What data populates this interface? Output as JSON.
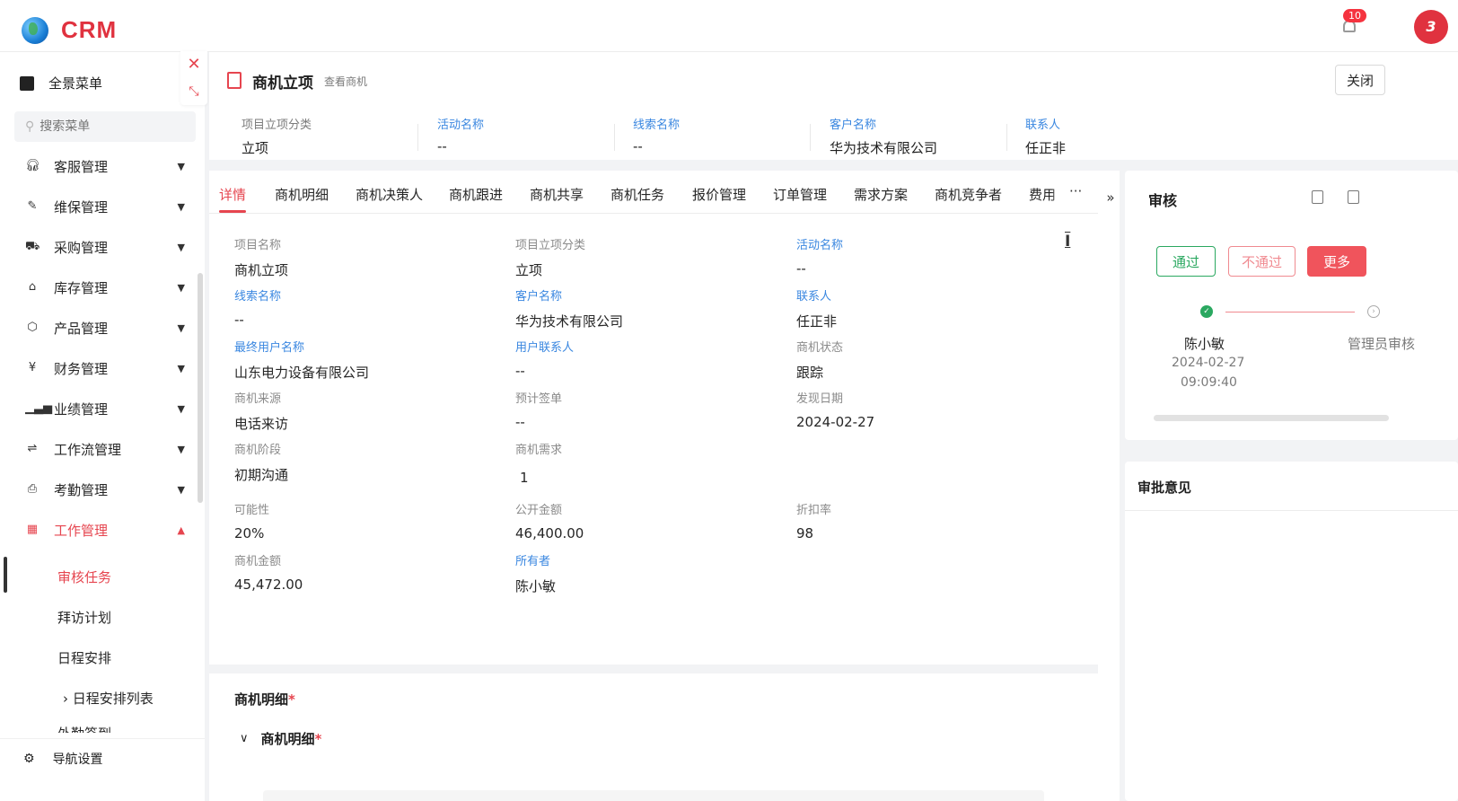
{
  "app": {
    "logo_text": "CRM",
    "notification_count": "10",
    "avatar_text": "3"
  },
  "sidebar": {
    "full_menu": "全景菜单",
    "search_placeholder": "搜索菜单",
    "items": [
      {
        "label": "客服管理",
        "icon": "headset-icon"
      },
      {
        "label": "维保管理",
        "icon": "wrench-icon"
      },
      {
        "label": "采购管理",
        "icon": "cart-icon"
      },
      {
        "label": "库存管理",
        "icon": "warehouse-icon"
      },
      {
        "label": "产品管理",
        "icon": "box-icon"
      },
      {
        "label": "财务管理",
        "icon": "finance-icon"
      },
      {
        "label": "业绩管理",
        "icon": "chart-icon"
      },
      {
        "label": "工作流管理",
        "icon": "workflow-icon"
      },
      {
        "label": "考勤管理",
        "icon": "attendance-icon"
      },
      {
        "label": "工作管理",
        "icon": "grid-icon"
      }
    ],
    "sub_items": [
      "审核任务",
      "拜访计划",
      "日程安排",
      "日程安排列表",
      "外勤签到"
    ],
    "bottom": "导航设置"
  },
  "header": {
    "title": "商机立项",
    "subtitle": "查看商机",
    "close_label": "关闭"
  },
  "summary": [
    {
      "label": "项目立项分类",
      "value": "立项",
      "link": false
    },
    {
      "label": "活动名称",
      "value": "--",
      "link": true
    },
    {
      "label": "线索名称",
      "value": "--",
      "link": true
    },
    {
      "label": "客户名称",
      "value": "华为技术有限公司",
      "link": true
    },
    {
      "label": "联系人",
      "value": "任正非",
      "link": true
    }
  ],
  "tabs": [
    "详情",
    "商机明细",
    "商机决策人",
    "商机跟进",
    "商机共享",
    "商机任务",
    "报价管理",
    "订单管理",
    "需求方案",
    "商机竞争者",
    "费用"
  ],
  "tabs_more": "···",
  "detail": {
    "fields": [
      {
        "label": "项目名称",
        "value": "商机立项",
        "link": false
      },
      {
        "label": "项目立项分类",
        "value": "立项",
        "link": false
      },
      {
        "label": "活动名称",
        "value": "--",
        "link": true
      },
      {
        "label": "线索名称",
        "value": "--",
        "link": true
      },
      {
        "label": "客户名称",
        "value": "华为技术有限公司",
        "link": true
      },
      {
        "label": "联系人",
        "value": "任正非",
        "link": true
      },
      {
        "label": "最终用户名称",
        "value": "山东电力设备有限公司",
        "link": true
      },
      {
        "label": "用户联系人",
        "value": "--",
        "link": true
      },
      {
        "label": "商机状态",
        "value": "跟踪",
        "link": false
      },
      {
        "label": "商机来源",
        "value": "电话来访",
        "link": false
      },
      {
        "label": "预计签单",
        "value": "--",
        "link": false
      },
      {
        "label": "发现日期",
        "value": "2024-02-27",
        "link": false
      },
      {
        "label": "商机阶段",
        "value": "初期沟通",
        "link": false
      },
      {
        "label": "商机需求",
        "value": "1",
        "link": false
      },
      {
        "label": "可能性",
        "value": "20%",
        "link": false
      },
      {
        "label": "公开金额",
        "value": "46,400.00",
        "link": false
      },
      {
        "label": "折扣率",
        "value": "98",
        "link": false
      },
      {
        "label": "商机金额",
        "value": "45,472.00",
        "link": false
      },
      {
        "label": "所有者",
        "value": "陈小敏",
        "link": true
      }
    ]
  },
  "section": {
    "title": "商机明细",
    "sub_title": "商机明细",
    "required_mark": "*"
  },
  "audit": {
    "title": "审核",
    "pass_label": "通过",
    "reject_label": "不通过",
    "more_label": "更多",
    "step1_name": "陈小敏",
    "step1_date": "2024-02-27",
    "step1_time": "09:09:40",
    "step2_name": "管理员审核"
  },
  "opinion": {
    "title": "审批意见"
  },
  "colors": {
    "accent": "#e6454f",
    "link": "#3a87e0",
    "success": "#2aa860"
  }
}
